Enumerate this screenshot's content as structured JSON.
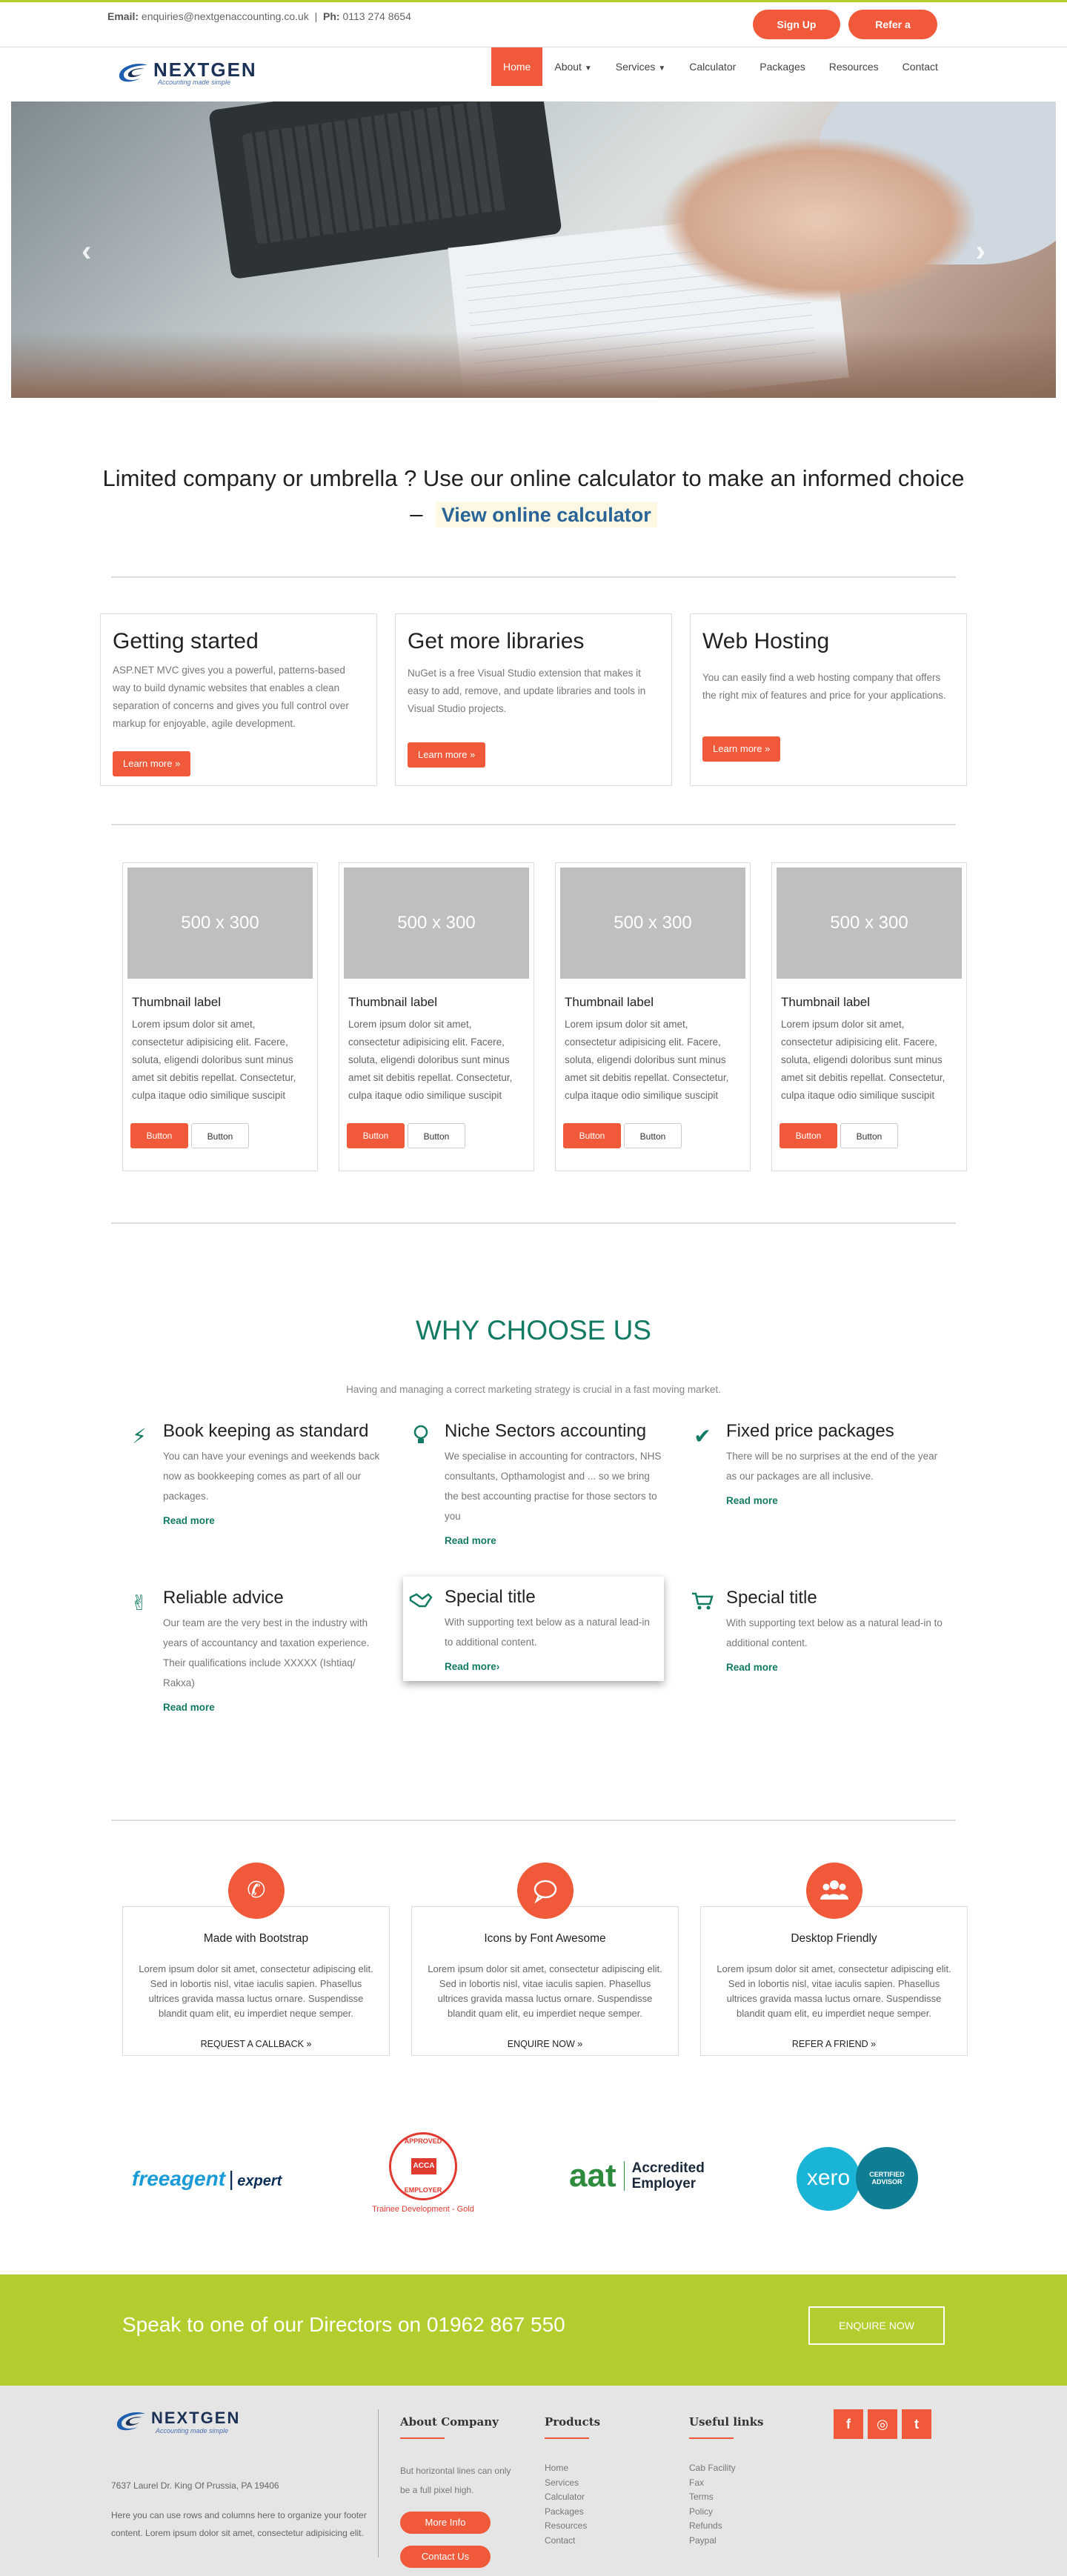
{
  "topbar": {
    "email_label": "Email:",
    "email": "enquiries@nextgenaccounting.co.uk",
    "divider": "|",
    "phone_label": "Ph:",
    "phone": "0113 274 8654",
    "signup": "Sign Up",
    "refer": "Refer a friend"
  },
  "brand": {
    "name": "NEXTGEN",
    "tagline": "Accounting made simple"
  },
  "nav": {
    "home": "Home",
    "about": "About",
    "services": "Services",
    "calculator": "Calculator",
    "packages": "Packages",
    "resources": "Resources",
    "contact": "Contact"
  },
  "callout": {
    "line1": "Limited company or umbrella ? Use our online calculator to make an informed choice",
    "dash": "–",
    "link": "View online calculator"
  },
  "features": [
    {
      "title": "Getting started",
      "text": "ASP.NET MVC gives you a powerful, patterns-based way to build dynamic websites that enables a clean separation of concerns and gives you full control over markup for enjoyable, agile development.",
      "btn": "Learn more »"
    },
    {
      "title": "Get more libraries",
      "text": "NuGet is a free Visual Studio extension that makes it easy to add, remove, and update libraries and tools in Visual Studio projects.",
      "btn": "Learn more »"
    },
    {
      "title": "Web Hosting",
      "text": "You can easily find a web hosting company that offers the right mix of features and price for your applications.",
      "btn": "Learn more »"
    }
  ],
  "thumbs": {
    "placeholder": "500 x 300",
    "label": "Thumbnail label",
    "text": "Lorem ipsum dolor sit amet, consectetur adipisicing elit. Facere, soluta, eligendi doloribus sunt minus amet sit debitis repellat. Consectetur, culpa itaque odio similique suscipit",
    "btn1": "Button",
    "btn2": "Button"
  },
  "why": {
    "title": "WHY CHOOSE US",
    "subtitle": "Having and managing a correct marketing strategy is crucial in a fast moving market.",
    "items": [
      {
        "icon": "bolt-icon",
        "title": "Book keeping as standard",
        "text": "You can have your evenings and weekends back now as bookkeeping comes as part of all our packages.",
        "link": "Read more"
      },
      {
        "icon": "lightbulb-icon",
        "title": "Niche Sectors accounting",
        "text": "We specialise in accounting for contractors, NHS consultants, Opthamologist and ... so we bring the best accounting practise for those sectors to you",
        "link": "Read more"
      },
      {
        "icon": "check-icon",
        "title": "Fixed price packages",
        "text": "There will be no surprises at the end of the year as our packages are all inclusive.",
        "link": "Read more"
      },
      {
        "icon": "peace-hand-icon",
        "title": "Reliable advice",
        "text": "Our team are the very best in the industry with years of accountancy and taxation experience. Their qualifications include XXXXX (Ishtiaq/ Rakxa)",
        "link": "Read more"
      },
      {
        "icon": "handshake-icon",
        "title": "Special title",
        "text": "With supporting text below as a natural lead-in to additional content.",
        "link": "Read more›"
      },
      {
        "icon": "cart-icon",
        "title": "Special title",
        "text": "With supporting text below as a natural lead-in to additional content.",
        "link": "Read more"
      }
    ]
  },
  "services": [
    {
      "icon": "phone-icon",
      "title": "Made with Bootstrap",
      "text": "Lorem ipsum dolor sit amet, consectetur adipiscing elit. Sed in lobortis nisl, vitae iaculis sapien. Phasellus ultrices gravida massa luctus ornare. Suspendisse blandit quam elit, eu imperdiet neque semper.",
      "link": "REQUEST A CALLBACK »"
    },
    {
      "icon": "chat-icon",
      "title": "Icons by Font Awesome",
      "text": "Lorem ipsum dolor sit amet, consectetur adipiscing elit. Sed in lobortis nisl, vitae iaculis sapien. Phasellus ultrices gravida massa luctus ornare. Suspendisse blandit quam elit, eu imperdiet neque semper.",
      "link": "ENQUIRE NOW »"
    },
    {
      "icon": "users-icon",
      "title": "Desktop Friendly",
      "text": "Lorem ipsum dolor sit amet, consectetur adipiscing elit. Sed in lobortis nisl, vitae iaculis sapien. Phasellus ultrices gravida massa luctus ornare. Suspendisse blandit quam elit, eu imperdiet neque semper.",
      "link": "REFER A FRIEND »"
    }
  ],
  "logos": {
    "freeagent_1": "freeagent",
    "freeagent_2": "expert",
    "acca_top": "APPROVED",
    "acca_mid": "ACCA",
    "acca_bottom": "EMPLOYER",
    "acca_caption": "Trainee Development - Gold",
    "aat_mark": "aat",
    "aat_1": "Accredited",
    "aat_2": "Employer",
    "xero": "xero",
    "xero_badge_1": "CERTIFIED",
    "xero_badge_2": "ADVISOR"
  },
  "cta": {
    "text": "Speak to one of our Directors on 01962 867 550",
    "button": "ENQUIRE NOW"
  },
  "footer": {
    "address": "7637 Laurel Dr. King Of Prussia, PA 19406",
    "desc": "Here you can use rows and columns here to organize your footer content. Lorem ipsum dolor sit amet, consectetur adipisicing elit.",
    "about_title": "About Company",
    "about_text": "But horizontal lines can only be a full pixel high.",
    "more_info": "More Info",
    "contact_us": "Contact Us",
    "products_title": "Products",
    "products": [
      "Home",
      "Services",
      "Calculator",
      "Packages",
      "Resources",
      "Contact"
    ],
    "useful_title": "Useful links",
    "useful": [
      "Cab Facility",
      "Fax",
      "Terms",
      "Policy",
      "Refunds",
      "Paypal"
    ],
    "social": [
      "f",
      "◎",
      "t"
    ]
  },
  "colors": {
    "accent": "#f05a3a",
    "green": "#137a63",
    "lime": "#b4cc2e",
    "navy": "#1b3156"
  }
}
